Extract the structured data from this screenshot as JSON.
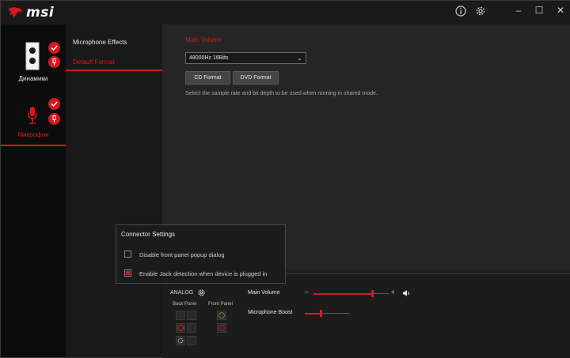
{
  "app": {
    "logo_text": "msi",
    "window_controls": {
      "minimize": "–",
      "maximize": "☐",
      "close": "✕"
    }
  },
  "devices": [
    {
      "label": "Динамики",
      "icon": "speaker-icon",
      "selected": false
    },
    {
      "label": "Микрофон",
      "icon": "microphone-icon",
      "selected": true
    }
  ],
  "submenu": {
    "items": [
      {
        "label": "Microphone Effects",
        "selected": false
      },
      {
        "label": "Default Format",
        "selected": true
      }
    ]
  },
  "main": {
    "section_label": "Main Volume",
    "format_select": {
      "value": "48000Hz 16Bits"
    },
    "cd_button": "CD Format",
    "dvd_button": "DVD Format",
    "description": "Select the sample rate and bit depth to be used when running in shared mode."
  },
  "bottom": {
    "analog_label": "ANALOG",
    "back_panel_label": "Back Panel",
    "front_panel_label": "Front Panel",
    "main_volume_label": "Main Volume",
    "minus": "–",
    "plus": "+",
    "main_volume_level": 0.78,
    "mic_boost_label": "Microphone Boost",
    "mic_boost_level": 0.35
  },
  "popup": {
    "title": "Connector Settings",
    "options": [
      {
        "label": "Disable front panel popup dialog",
        "checked": false
      },
      {
        "label": "Enable Jack detection when device is plugged in",
        "checked": true
      }
    ]
  },
  "colors": {
    "accent": "#d7191e",
    "background": "#1e1e1e"
  }
}
